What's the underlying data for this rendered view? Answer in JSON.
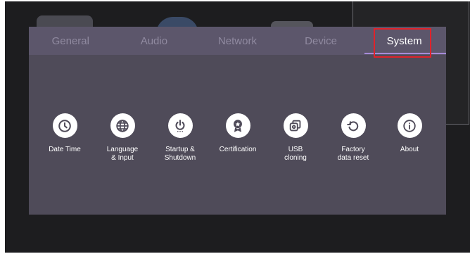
{
  "tabs": [
    {
      "label": "General"
    },
    {
      "label": "Audio"
    },
    {
      "label": "Network"
    },
    {
      "label": "Device"
    },
    {
      "label": "System"
    }
  ],
  "active_tab": "System",
  "items": [
    {
      "label": "Date Time",
      "icon": "clock-icon"
    },
    {
      "label": "Language\n& Input",
      "icon": "globe-icon"
    },
    {
      "label": "Startup &\nShutdown",
      "icon": "power-icon"
    },
    {
      "label": "Certification",
      "icon": "award-icon"
    },
    {
      "label": "USB\ncloning",
      "icon": "copy-icon"
    },
    {
      "label": "Factory\ndata reset",
      "icon": "reset-icon"
    },
    {
      "label": "About",
      "icon": "info-icon"
    }
  ],
  "colors": {
    "dialog_bg": "#4f4b59",
    "tabbar_bg": "#5c566b",
    "active_underline": "#a78bd8",
    "highlight_box": "#e0232b",
    "icon_color": "#4f4b59"
  }
}
